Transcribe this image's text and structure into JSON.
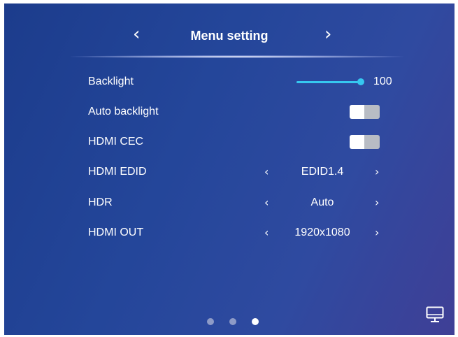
{
  "header": {
    "title": "Menu setting",
    "prev_label": "‹",
    "next_label": "›"
  },
  "settings": {
    "backlight": {
      "label": "Backlight",
      "value": "100",
      "level": 1.0,
      "accent": "#36c8f0"
    },
    "auto_backlight": {
      "label": "Auto backlight",
      "state": "off"
    },
    "hdmi_cec": {
      "label": "HDMI CEC",
      "state": "off"
    },
    "hdmi_edid": {
      "label": "HDMI EDID",
      "value": "EDID1.4"
    },
    "hdr": {
      "label": "HDR",
      "value": "Auto"
    },
    "hdmi_out": {
      "label": "HDMI OUT",
      "value": "1920x1080"
    }
  },
  "selector_arrows": {
    "prev": "‹",
    "next": "›"
  },
  "pagination": {
    "pages": 3,
    "active": 3
  },
  "icons": {
    "monitor": "monitor-icon"
  },
  "colors": {
    "background": "#24469a",
    "accent": "#36c8f0",
    "toggle_off": "#b8bcc4"
  }
}
